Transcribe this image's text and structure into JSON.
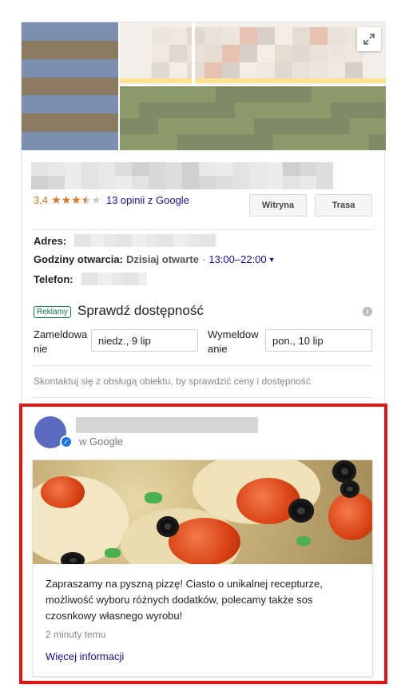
{
  "rating": {
    "score": "3,4",
    "stars_filled": 3.5,
    "stars_total": 5,
    "reviews_link": "13 opinii z Google"
  },
  "actions": {
    "website": "Witryna",
    "route": "Trasa"
  },
  "details": {
    "address_label": "Adres:",
    "hours_label": "Godziny otwarcia:",
    "hours_status": "Dzisiaj otwarte",
    "hours_separator": "·",
    "hours_range": "13:00–22:00",
    "phone_label": "Telefon:"
  },
  "availability": {
    "ad_badge": "Reklamy",
    "title": "Sprawdź dostępność",
    "checkin_label": "Zameldowanie",
    "checkin_value": "niedz., 9 lip",
    "checkout_label": "Wymeldowanie",
    "checkout_value": "pon., 10 lip",
    "contact_note": "Skontaktuj się z obsługą obiektu, by sprawdzić ceny i dostępność"
  },
  "post": {
    "source": "w Google",
    "text": "Zapraszamy na pyszną pizzę! Ciasto o unikalnej recepturze, możliwość wyboru różnych dodatków, polecamy także sos czosnkowy własnego wyrobu!",
    "time": "2 minuty temu",
    "more_link": "Więcej informacji"
  },
  "icons": {
    "expand": "expand-icon",
    "info": "info-icon",
    "verified": "verified-check-icon",
    "caret": "caret-down-icon"
  },
  "colors": {
    "star": "#e7711b",
    "link": "#1a0dab",
    "ad_green": "#0b8043",
    "highlight_red": "#e41515",
    "avatar": "#5c6bc0"
  }
}
